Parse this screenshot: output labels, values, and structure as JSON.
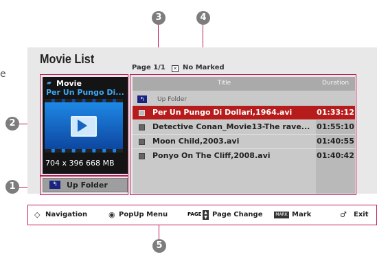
{
  "stray_text": "e",
  "callouts": [
    "1",
    "2",
    "3",
    "4",
    "5"
  ],
  "header": {
    "title": "Movie List",
    "page": "Page 1/1",
    "mark_status": "No Marked"
  },
  "preview": {
    "type_label": "Movie",
    "name": "Per Un Pungo Di...",
    "meta": "704 x 396  668 MB"
  },
  "up_folder_button": "Up Folder",
  "table": {
    "col_title": "Title",
    "col_duration": "Duration",
    "up_folder_row": "Up Folder",
    "rows": [
      {
        "name": "Per Un Pungo Di Dollari,1964.avi",
        "duration": "01:33:12",
        "selected": true
      },
      {
        "name": "Detective Conan_Movie13-The rave...",
        "duration": "01:55:10",
        "selected": false
      },
      {
        "name": "Moon Child,2003.avi",
        "duration": "01:40:55",
        "selected": false
      },
      {
        "name": "Ponyo On The Cliff,2008.avi",
        "duration": "01:40:42",
        "selected": false
      }
    ]
  },
  "nav_bar": {
    "navigation": "Navigation",
    "popup_menu": "PopUp Menu",
    "page_tag": "PAGE",
    "page_change": "Page Change",
    "mark_tag": "MARK",
    "mark": "Mark",
    "exit": "Exit"
  },
  "colors": {
    "accent": "#c2185b",
    "selected_row": "#b71c1c",
    "preview_name": "#3fa9f5",
    "callout": "#7d7d7d"
  },
  "icons": [
    "movie-icon",
    "folder-up-icon",
    "play-icon",
    "navigation-arrows-icon",
    "ok-button-icon",
    "page-updown-icon",
    "mark-key-icon",
    "exit-icon"
  ]
}
